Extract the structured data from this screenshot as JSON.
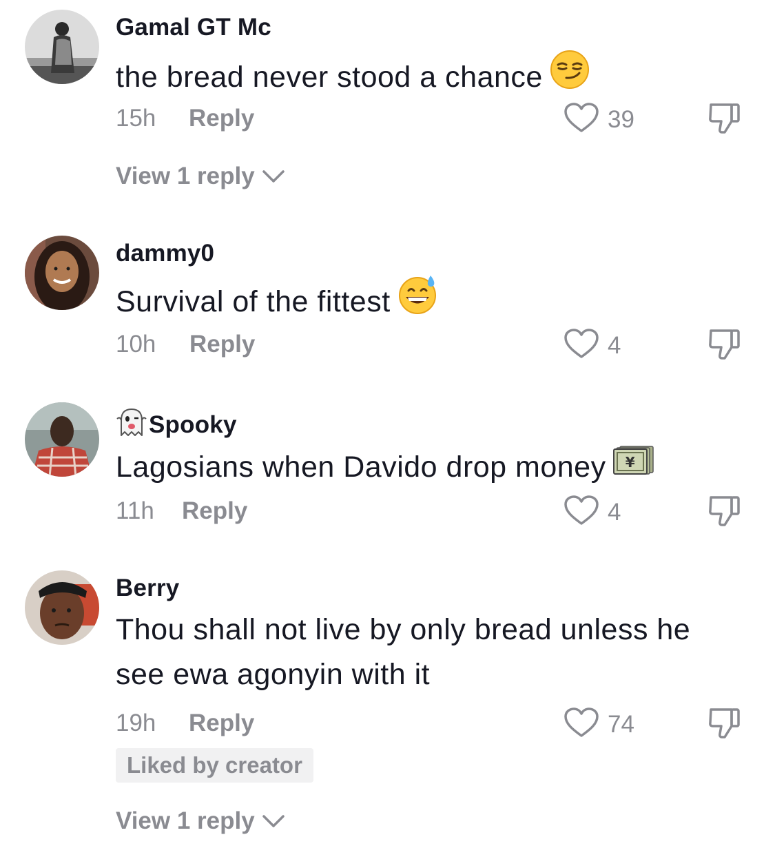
{
  "comments": [
    {
      "username": "Gamal GT Mc",
      "text": "the bread never stood a chance",
      "emoji": "smirking-face",
      "time": "15h",
      "reply_label": "Reply",
      "likes": "39",
      "view_replies": "View 1 reply"
    },
    {
      "username": "dammy0",
      "text": "Survival of the fittest",
      "emoji": "grinning-face-with-sweat",
      "time": "10h",
      "reply_label": "Reply",
      "likes": "4"
    },
    {
      "username_emoji": "ghost",
      "username": "Spooky",
      "text": "Lagosians when Davido drop money",
      "emoji": "yen-banknote",
      "time": "11h",
      "reply_label": "Reply",
      "likes": "4"
    },
    {
      "username": "Berry",
      "text_line1": "Thou shall not live by only bread unless he",
      "text_line2": "see ewa agonyin with it",
      "time": "19h",
      "reply_label": "Reply",
      "likes": "74",
      "liked_by_creator": "Liked by creator",
      "view_replies": "View 1 reply"
    }
  ],
  "colors": {
    "primary_text": "#161823",
    "secondary_text": "#8a8b91",
    "badge_bg": "#f1f1f2"
  }
}
